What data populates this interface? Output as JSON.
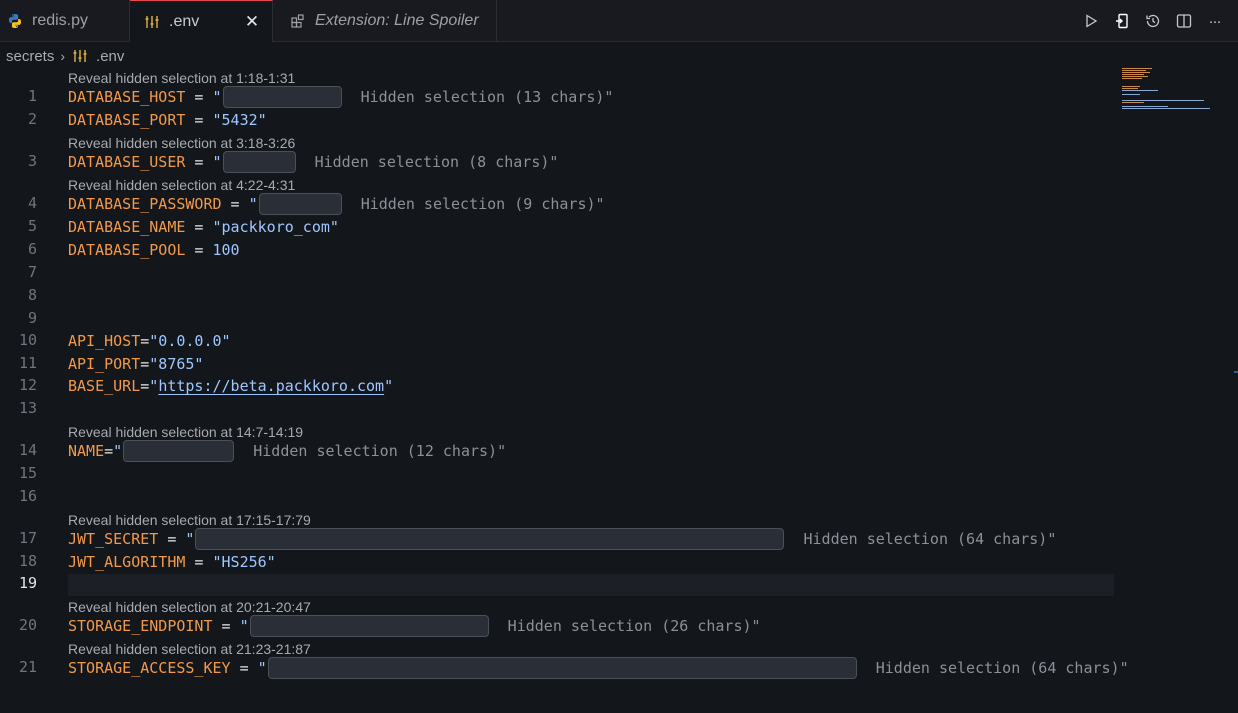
{
  "tabs": [
    {
      "label": "redis.py",
      "icon": "python-icon"
    },
    {
      "label": ".env",
      "icon": "settings-sliders-icon",
      "active": true
    },
    {
      "label": "Extension: Line Spoiler",
      "icon": "extension-icon"
    }
  ],
  "tab_close_glyph": "✕",
  "actions": [
    "run-icon",
    "open-changes-icon",
    "timeline-icon",
    "split-editor-icon",
    "more-actions-icon"
  ],
  "more_glyph": "···",
  "breadcrumb": {
    "folder": "secrets",
    "separator": "›",
    "file": ".env"
  },
  "codelens": {
    "l1": "Reveal hidden selection at 1:18-1:31",
    "l3": "Reveal hidden selection at 3:18-3:26",
    "l4": "Reveal hidden selection at 4:22-4:31",
    "l14": "Reveal hidden selection at 14:7-14:19",
    "l17": "Reveal hidden selection at 17:15-17:79",
    "l20": "Reveal hidden selection at 20:21-20:47",
    "l21": "Reveal hidden selection at 21:23-21:87"
  },
  "line_numbers": [
    "1",
    "2",
    "3",
    "4",
    "5",
    "6",
    "7",
    "8",
    "9",
    "10",
    "11",
    "12",
    "13",
    "14",
    "15",
    "16",
    "17",
    "18",
    "19",
    "20",
    "21"
  ],
  "current_line": "19",
  "lines": {
    "l1": {
      "key": "DATABASE_HOST",
      "op": " = ",
      "q": "\"",
      "note": "  Hidden selection (13 chars)\""
    },
    "l2": {
      "key": "DATABASE_PORT",
      "op": " = ",
      "val": "\"5432\""
    },
    "l3": {
      "key": "DATABASE_USER",
      "op": " = ",
      "q": "\"",
      "note": "  Hidden selection (8 chars)\""
    },
    "l4": {
      "key": "DATABASE_PASSWORD",
      "op": " = ",
      "q": "\"",
      "note": "  Hidden selection (9 chars)\""
    },
    "l5": {
      "key": "DATABASE_NAME",
      "op": " = ",
      "val": "\"packkoro_com\""
    },
    "l6": {
      "key": "DATABASE_POOL",
      "op": " = ",
      "val": "100"
    },
    "l10": {
      "key": "API_HOST",
      "op": "=",
      "val": "\"0.0.0.0\""
    },
    "l11": {
      "key": "API_PORT",
      "op": "=",
      "val": "\"8765\""
    },
    "l12": {
      "key": "BASE_URL",
      "op": "=",
      "q": "\"",
      "url": "https://beta.packkoro.com",
      "q2": "\""
    },
    "l14": {
      "key": "NAME",
      "op": "=",
      "q": "\"",
      "note": "  Hidden selection (12 chars)\""
    },
    "l17": {
      "key": "JWT_SECRET",
      "op": " = ",
      "q": "\"",
      "note": "  Hidden selection (64 chars)\""
    },
    "l18": {
      "key": "JWT_ALGORITHM",
      "op": " = ",
      "val": "\"HS256\""
    },
    "l20": {
      "key": "STORAGE_ENDPOINT",
      "op": " = ",
      "q": "\"",
      "note": "  Hidden selection (26 chars)\""
    },
    "l21": {
      "key": "STORAGE_ACCESS_KEY",
      "op": " = ",
      "q": "\"",
      "note": "  Hidden selection (64 chars)\""
    }
  },
  "colors": {
    "accent_tab_border": "#e5484d",
    "key": "#f2994a",
    "string": "#9fc7ff",
    "background": "#13161b"
  }
}
